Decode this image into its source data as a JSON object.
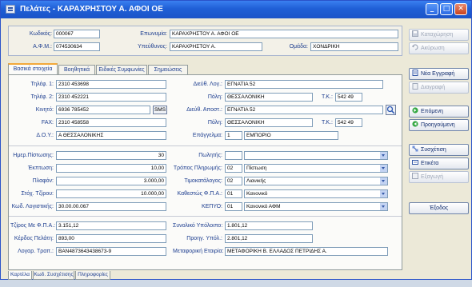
{
  "window": {
    "title": "Πελάτες - ΚΑΡΑΧΡΗΣΤΟΥ Α. ΑΦΟΙ ΟΕ"
  },
  "header": {
    "code_label": "Κωδικός:",
    "code_value": "000067",
    "afm_label": "Α.Φ.Μ.:",
    "afm_value": "074530634",
    "name_label": "Επωνυμία:",
    "name_value": "ΚΑΡΑΧΡΗΣΤΟΥ Α. ΑΦΟΙ ΟΕ",
    "resp_label": "Υπεύθυνος:",
    "resp_value": "ΚΑΡΑΧΡΗΣΤΟΥ Α.",
    "group_label": "Ομάδα:",
    "group_value": "ΧΟΝΔΡΙΚΗ"
  },
  "tabs": [
    "Βασικά στοιχεία",
    "Βοηθητικά",
    "Ειδικές Συμφωνίες",
    "Σημειώσεις"
  ],
  "contact": {
    "phone1_label": "Τηλέφ. 1:",
    "phone1": "2310 453698",
    "phone2_label": "Τηλέφ. 2:",
    "phone2": "2310 452221",
    "mobile_label": "Κινητό:",
    "mobile": "6936 785452",
    "sms_label": "SMS",
    "fax_label": "FAX:",
    "fax": "2310 458558",
    "doy_label": "Δ.Ο.Υ.:",
    "doy": "Α ΘΕΣΣΑΛΟΝΙΚΗΣ",
    "addr_label": "Διεύθ. Λογ.:",
    "addr": "ΕΓΝΑΤΙΑ 52",
    "city_label": "Πόλη:",
    "city": "ΘΕΣΣΑΛΟΝΙΚΗ",
    "tk_label": "Τ.Κ.:",
    "tk": "542 49",
    "ship_label": "Διεύθ. Αποστ.:",
    "ship": "ΕΓΝΑΤΙΑ 52",
    "city2_label": "Πόλη:",
    "city2": "ΘΕΣΣΑΛΟΝΙΚΗ",
    "tk2_label": "Τ.Κ.:",
    "tk2": "542 49",
    "prof_label": "Επάγγελμα:",
    "prof_code": "1",
    "prof_name": "ΕΜΠΟΡΙΟ"
  },
  "finance": {
    "days_label": "Ημερ.Πίστωσης:",
    "days": "30",
    "disc_label": "Έκπτωση:",
    "disc": "10,00",
    "margin_label": "Πλαφόν:",
    "margin": "3.000,00",
    "target_label": "Στόχ. Τζίρου:",
    "target": "10.000,00",
    "acct_label": "Κωδ. Λογιστικής:",
    "acct": "30.00.00.067",
    "seller_label": "Πωλητής:",
    "seller": "",
    "pay_label": "Τρόπος Πληρωμής:",
    "pay_code": "02",
    "pay_name": "Πίστωση",
    "price_label": "Τιμοκατάλογος:",
    "price_code": "02",
    "price_name": "Λιανικής",
    "vat_label": "Καθεστώς Φ.Π.Α.:",
    "vat_code": "01",
    "vat_name": "Κανονικό",
    "kepyo_label": "ΚΕΠΥΟ:",
    "kepyo_code": "01",
    "kepyo_name": "Κανονικό ΑΦΜ"
  },
  "totals": {
    "turnover_label": "Τζίρος Με Φ.Π.Α.:",
    "turnover": "3.151,12",
    "profit_label": "Κέρδος Πελάτη:",
    "profit": "893,00",
    "bank_label": "Λογαρ. Τραπ.:",
    "bank": "ΒΑΝ4873643438673-9",
    "balance_label": "Συνολικό Υπόλοιπο:",
    "balance": "1.801,12",
    "prev_label": "Προηγ. Υπόλ.:",
    "prev": "2.801,12",
    "transport_label": "Μεταφορική Εταιρία:",
    "transport": "ΜΕΤΑΦΟΡΙΚΗ Β. ΕΛΛΑΔΟΣ ΠΕΤΡΙΔΗΣ Α."
  },
  "side_buttons": {
    "save": "Καταχώρηση",
    "cancel": "Ακύρωση",
    "new": "Νέα Εγγραφή",
    "delete": "Διαγραφή",
    "next": "Επόμενη",
    "prev": "Προηγούμενη",
    "link": "Συσχέτιση",
    "label": "Ετικέτα",
    "export": "Εξαγωγή",
    "exit": "Έξοδος"
  },
  "bottom_tabs": [
    "Καρτέλα",
    "Κωδ. Συσχέτισης",
    "Πληροφορίες"
  ],
  "colors": {
    "title_bar": "#1f5fd6",
    "accent_orange": "#f2a93b",
    "label_blue": "#1c3d8f"
  }
}
